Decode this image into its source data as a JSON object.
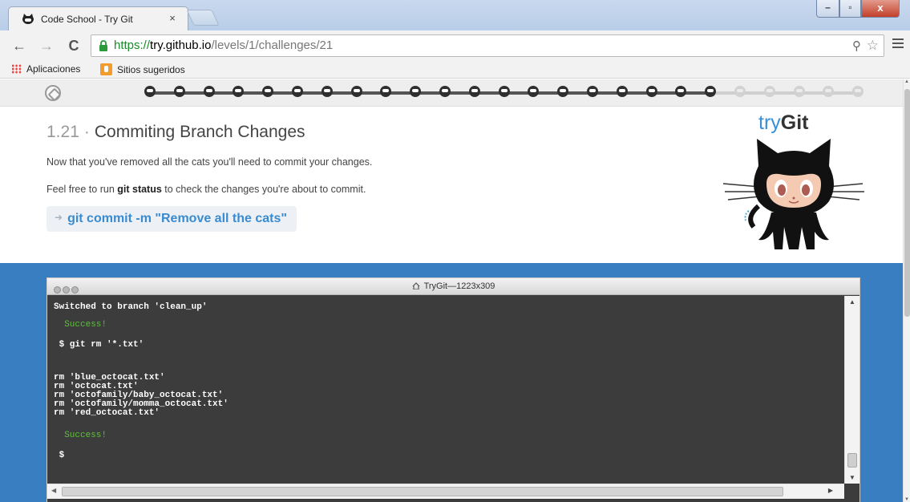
{
  "browser": {
    "tab_title": "Code School - Try Git",
    "tab_close": "×",
    "url": {
      "scheme": "https://",
      "host": "try.github.io",
      "path": "/levels/1/challenges/21"
    },
    "window_controls": {
      "minimize": "–",
      "maximize": "▫",
      "close": "x"
    },
    "bookmarks": [
      {
        "label": "Aplicaciones",
        "icon": "apps-grid-icon"
      },
      {
        "label": "Sitios sugeridos",
        "icon": "suggested-sites-icon"
      }
    ]
  },
  "progress": {
    "total_steps": 25,
    "completed_steps": 20,
    "current_step": 21
  },
  "lesson": {
    "number": "1.21",
    "separator": "·",
    "title": "Commiting Branch Changes",
    "instruction_1": "Now that you've removed all the cats you'll need to commit your changes.",
    "instruction_2_pre": "Feel free to run ",
    "instruction_2_cmd": "git status",
    "instruction_2_post": " to check the changes you're about to commit.",
    "command": "git commit -m \"Remove all the cats\""
  },
  "logo": {
    "try": "try",
    "git": "Git"
  },
  "terminal": {
    "title": "TryGit—1223x309",
    "lines": [
      {
        "text": "Switched to branch 'clean_up'",
        "kind": "out"
      },
      {
        "text": "  Success!",
        "kind": "ok"
      },
      {
        "text": " $ git rm '*.txt'",
        "kind": "out"
      },
      {
        "text": "rm 'blue_octocat.txt'",
        "kind": "out"
      },
      {
        "text": "rm 'octocat.txt'",
        "kind": "out"
      },
      {
        "text": "rm 'octofamily/baby_octocat.txt'",
        "kind": "out"
      },
      {
        "text": "rm 'octofamily/momma_octocat.txt'",
        "kind": "out"
      },
      {
        "text": "rm 'red_octocat.txt'",
        "kind": "out"
      },
      {
        "text": "  Success!",
        "kind": "ok"
      },
      {
        "text": " $",
        "kind": "out"
      }
    ]
  },
  "colors": {
    "stage": "#3a7ec2",
    "command": "#3a8bd0",
    "success": "#5bc236",
    "url_scheme": "#188b2b"
  }
}
